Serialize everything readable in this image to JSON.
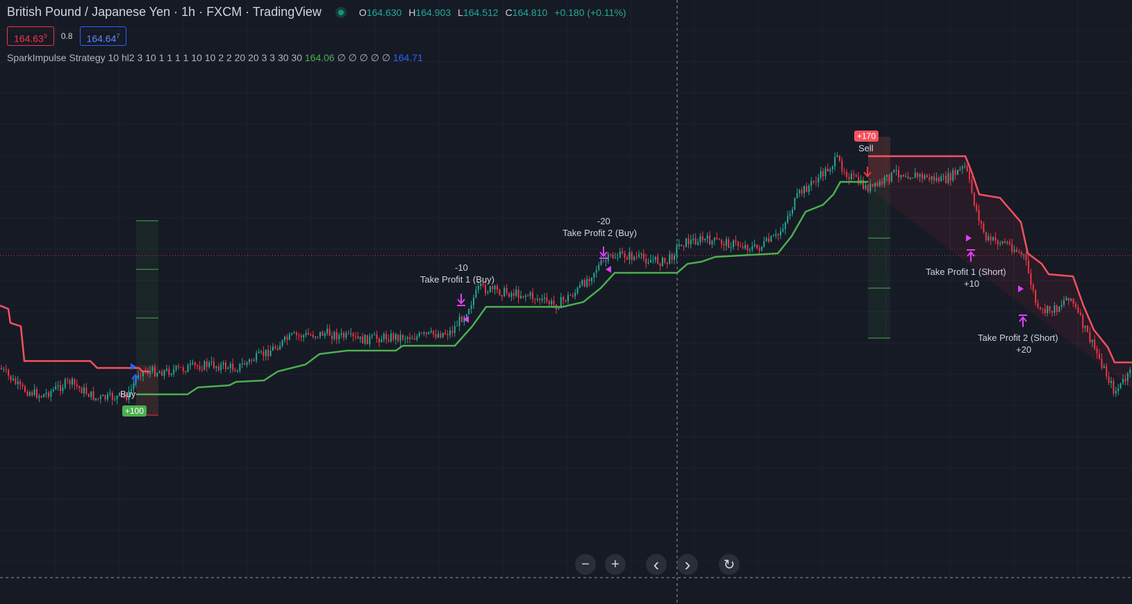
{
  "header": {
    "symbol_title": "British Pound / Japanese Yen · 1h · FXCM · TradingView",
    "ohlc": [
      {
        "key": "O",
        "value": "164.630"
      },
      {
        "key": "H",
        "value": "164.903"
      },
      {
        "key": "L",
        "value": "164.512"
      },
      {
        "key": "C",
        "value": "164.810"
      }
    ],
    "change": "+0.180 (+0.11%)"
  },
  "quote": {
    "sell_price": "164.63",
    "sell_price_sup": "9",
    "spread": "0.8",
    "buy_price": "164.64",
    "buy_price_sup": "7"
  },
  "indicator": {
    "name": "SparkImpulse Strategy",
    "params": "10 hl2 3 10 1 1 1 1 10 10 2 2 20 20 3 3 30 30",
    "value1": "164.06",
    "empties": "∅ ∅ ∅ ∅ ∅",
    "value2": "164.71"
  },
  "markers": {
    "buy_label": "Buy",
    "buy_badge": "+100",
    "tp1_buy_amount": "-10",
    "tp1_buy_label": "Take Profit 1 (Buy)",
    "tp2_buy_amount": "-20",
    "tp2_buy_label": "Take Profit 2 (Buy)",
    "sell_badge": "+170",
    "sell_label": "Sell",
    "tp1_short_label": "Take Profit 1 (Short)",
    "tp1_short_amount": "+10",
    "tp2_short_label": "Take Profit 2 (Short)",
    "tp2_short_amount": "+20"
  },
  "nav": {
    "zoom_out": "−",
    "zoom_in": "+",
    "scroll_left": "‹",
    "scroll_right": "›",
    "reset": "↻"
  },
  "colors": {
    "background": "#161a25",
    "up_candle": "#22ab94",
    "down_candle": "#f23645",
    "support_line": "#4caf50",
    "resistance_line": "#f7525f",
    "tp_marker": "#e040fb",
    "entry_arrow": "#2962ff"
  }
}
